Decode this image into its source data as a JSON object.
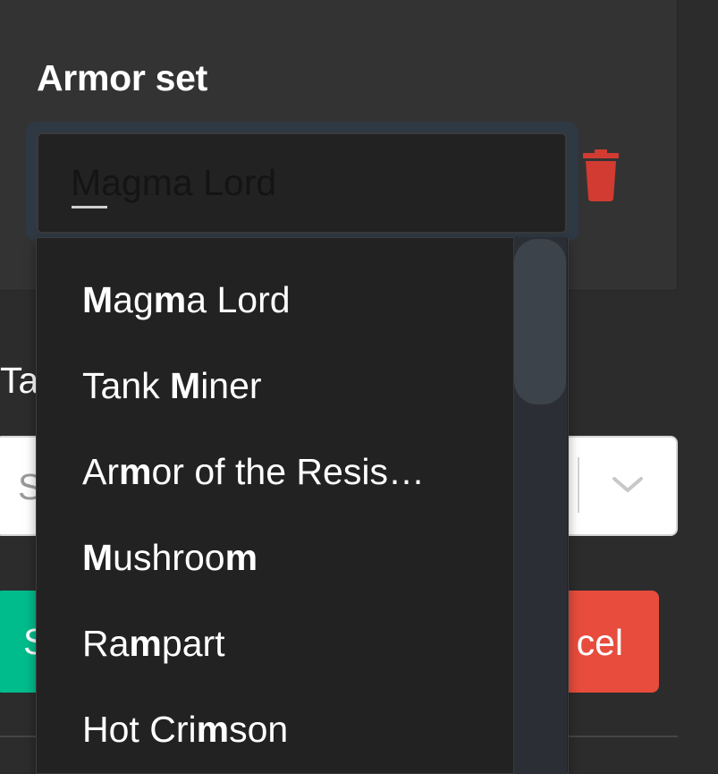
{
  "form": {
    "armor_section": {
      "title": "Armor set",
      "input_value": "",
      "input_placeholder": "Magma Lord",
      "delete_icon": "trash-icon"
    },
    "tab_label": "Ta",
    "select": {
      "placeholder": "S",
      "chevron_icon": "chevron-down-icon"
    },
    "buttons": {
      "save_label": "S",
      "cancel_label": "cel"
    }
  },
  "dropdown": {
    "options": [
      {
        "label": "Magma Lord"
      },
      {
        "label": "Tank Miner"
      },
      {
        "label": "Armor of the Resis…"
      },
      {
        "label": "Mushroom"
      },
      {
        "label": "Rampart"
      },
      {
        "label": "Hot Crimson"
      }
    ]
  },
  "colors": {
    "panel": "#333333",
    "background": "#2c2c2c",
    "dropdown": "#222222",
    "focus_ring": "#2f3944",
    "danger": "#e74c3c",
    "trash": "#d13b32",
    "success": "#00bc8c"
  }
}
